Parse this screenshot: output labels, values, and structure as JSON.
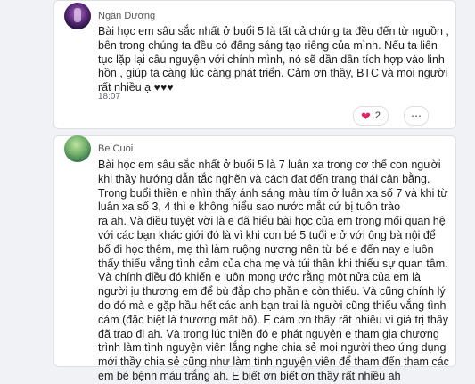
{
  "comments": [
    {
      "author": "Ngân Dương",
      "lines": [
        "Bài học em sâu sắc nhất ở buổi 5 là tất cả chúng ta đều đến từ nguồn ,",
        "bên trong chúng ta đều có đấng sáng tạo riêng của mình. Nếu ta liên",
        "tục lặp lại câu nguyện với chính mình, nó sẽ dần dần tích hợp vào linh",
        "hồn , giúp ta càng lúc càng phát triển. Cảm ơn thầy, BTC và mọi người",
        "rất nhiều ạ ♥♥♥"
      ],
      "time": "18:07",
      "reaction": {
        "icon": "heart-icon",
        "count": "2"
      },
      "more_icon": "more-icon"
    },
    {
      "author": "Be Cuoi",
      "lines": [
        "Bài học em sâu sắc nhất ở buổi 5 là 7 luân xa trong cơ thể con người",
        "khi thầy hướng dẫn tắc nghẽn và cách đạt đến trạng thái cân bằng.",
        "Trong buổi thiền e nhìn thấy ánh sáng màu tím ở luân xa số 7 và khi từ",
        "luân xa số 3, 4 thì e không hiểu sao nước mắt cứ bị tuôn trào",
        "ra ah. Và điều tuyệt vời là e đã hiểu bài học của em trong mối quan hệ",
        "với các bạn khác giới đó là vì khi con bé 5 tuổi e ở với ông bà nội để",
        "bố đi học thêm, mẹ thì làm ruộng nương nên từ bé e đến nay e luôn",
        "thấy thiếu vắng tình cảm của cha mẹ và túi thân khi thiếu sự quan tâm.",
        "Và chính điều đó khiến e luôn mong ước rằng một nửa của em là",
        "người ịu thương em để bù đắp cho phần e còn thiếu. Và cũng chính lý",
        "do đó mà e gặp hầu hết các anh bạn trai là người cũng thiếu vắng tình",
        "cảm (đặc biệt là thương mất bố). E cảm ơn thầy rất nhiều vì giá trị thầy",
        "đã trao đi ah. Và trong lúc thiền đó e phát nguyện e tham gia chương",
        "trình làm tình nguyện viên lắng nghe chia sẻ mọi người theo ứng dụng",
        "mới thầy chia sẻ cũng như làm tình nguyện viên để tham đến tham các",
        "em bé bệnh máu trắng ah. E biết ơn biết ơn thầy rất nhiều ah"
      ]
    }
  ],
  "colors": {
    "heart": "#e0245e",
    "card_bg": "#ffffff",
    "page_bg": "#f0f2f5"
  }
}
